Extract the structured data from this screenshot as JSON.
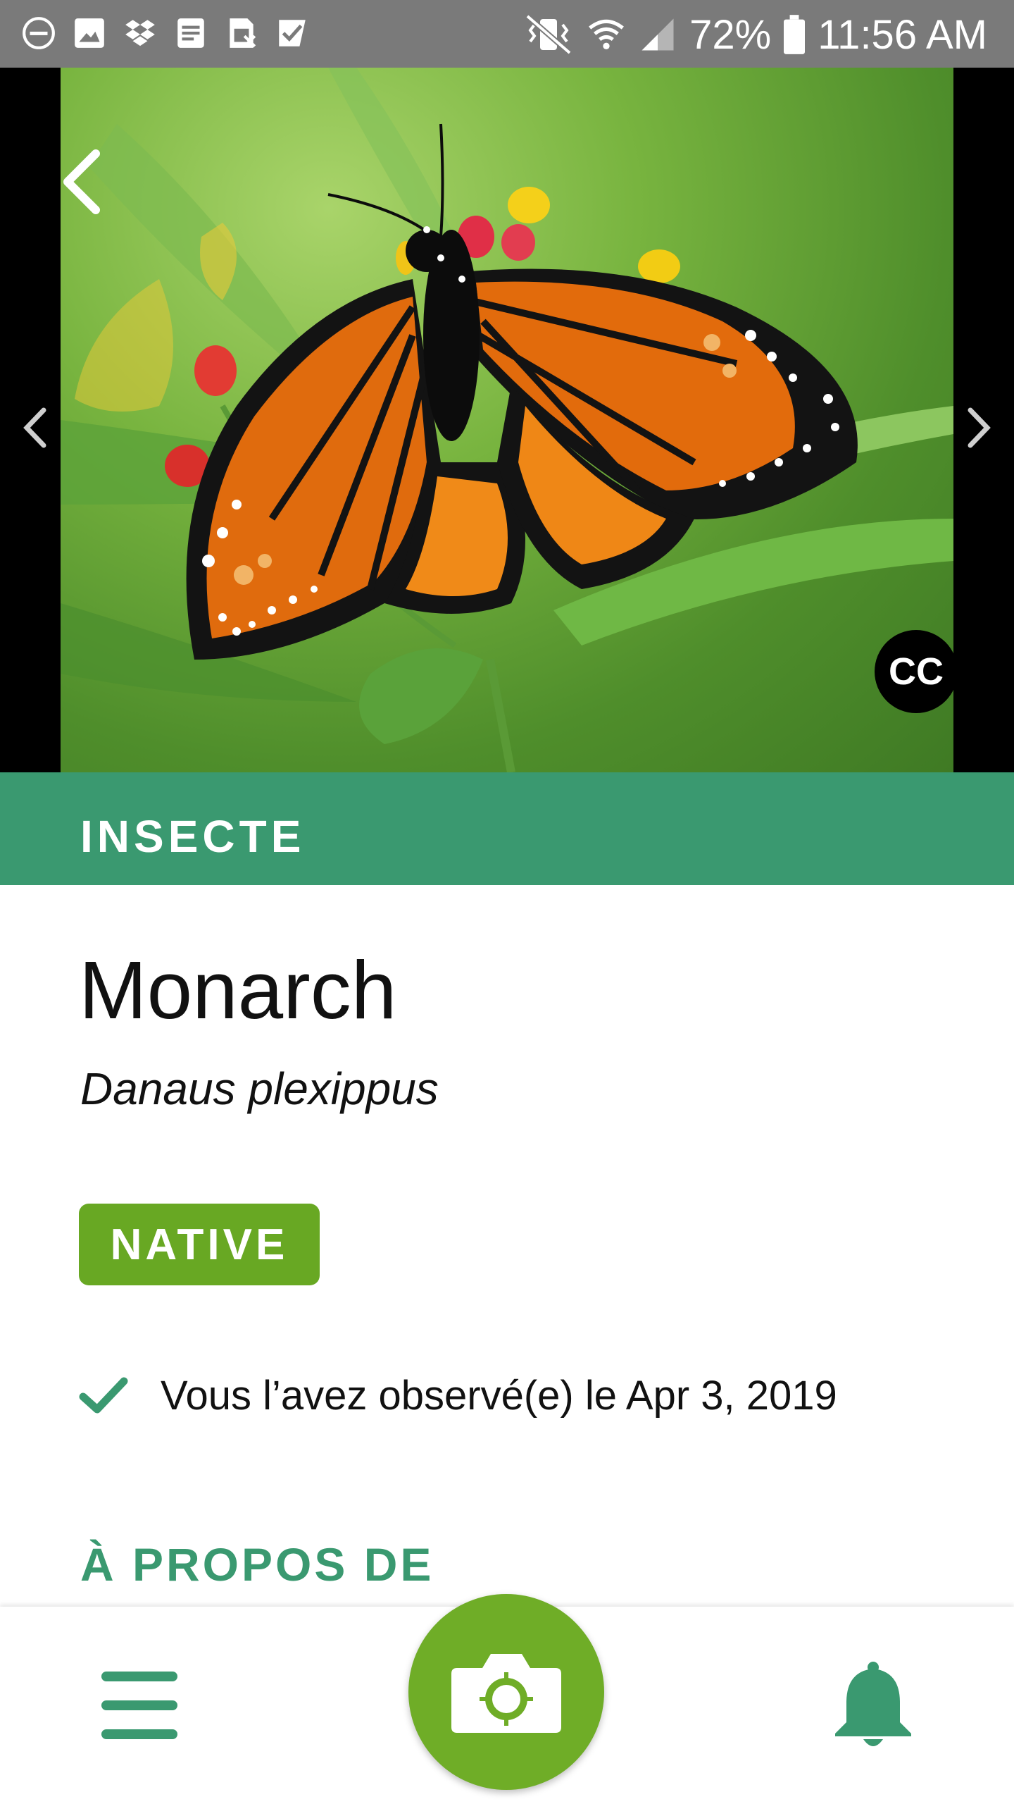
{
  "status_bar": {
    "battery": "72%",
    "time": "11:56 AM",
    "left_icons": [
      "do-not-disturb-icon",
      "image-icon",
      "dropbox-icon",
      "notes-icon",
      "sim-icon",
      "checkmark-app-icon"
    ],
    "right_icons": [
      "vibrate-icon",
      "wifi-icon",
      "signal-icon",
      "battery-icon"
    ]
  },
  "hero": {
    "photo": "monarch-butterfly-photo",
    "cc_label": "CC"
  },
  "species": {
    "category": "INSECTE",
    "common_name": "Monarch",
    "scientific_name": "Danaus plexippus",
    "status_badge": "NATIVE",
    "observed_text": "Vous l’avez observé(e) le Apr 3, 2019"
  },
  "section": {
    "about_heading": "À PROPOS DE"
  },
  "bottom_nav": {
    "icons": [
      "menu-icon",
      "camera-icon",
      "bell-icon"
    ]
  },
  "colors": {
    "status_bar": "#7a7a7a",
    "category_band": "#3a9970",
    "native_badge": "#68a823",
    "camera_button": "#6fad27",
    "accent_text": "#3a9970"
  }
}
